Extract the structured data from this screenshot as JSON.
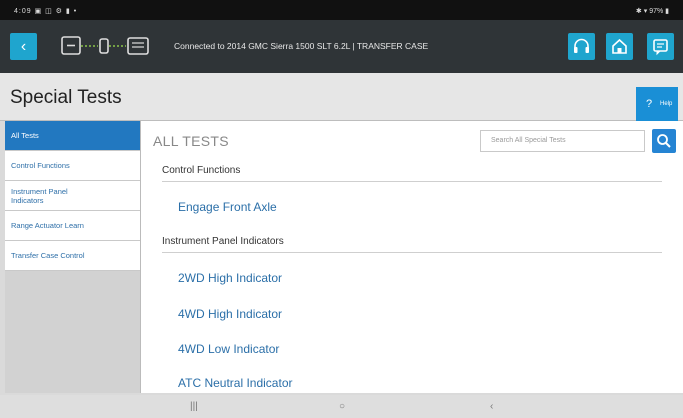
{
  "statusbar": {
    "left": "4:09 ▣ ◫ ⚙ ▮ •",
    "right": "✱ ▾ 97% ▮"
  },
  "appbar": {
    "back_icon": "back-arrow-icon",
    "connection_text": "Connected to 2014 GMC Sierra 1500 SLT 6.2L | TRANSFER CASE",
    "icons": [
      "headset-icon",
      "home-icon",
      "report-icon"
    ],
    "accent": "#1fa5ce",
    "stripe_colors": [
      "#2e3a8f",
      "#3f4fb0",
      "#7a3b94",
      "#b04f9b",
      "#1f8fd0",
      "#5dbb46",
      "#9fd15a",
      "#3fb9b0"
    ]
  },
  "page": {
    "title": "Special Tests",
    "help": {
      "icon": "?",
      "text": "Help"
    }
  },
  "sidebar": {
    "items": [
      {
        "label": "All Tests",
        "active": true
      },
      {
        "label": "Control Functions"
      },
      {
        "label": "Instrument Panel Indicators"
      },
      {
        "label": "Range Actuator Learn"
      },
      {
        "label": "Transfer Case Control"
      }
    ]
  },
  "main": {
    "heading": "ALL TESTS",
    "search_placeholder": "Search All Special Tests",
    "groups": [
      {
        "title": "Control Functions",
        "tests": [
          "Engage Front Axle"
        ]
      },
      {
        "title": "Instrument Panel Indicators",
        "tests": [
          "2WD High Indicator",
          "4WD High Indicator",
          "4WD Low Indicator",
          "ATC Neutral Indicator"
        ]
      }
    ]
  },
  "navbar": {
    "recent": "|||",
    "home": "○",
    "back": "‹"
  }
}
